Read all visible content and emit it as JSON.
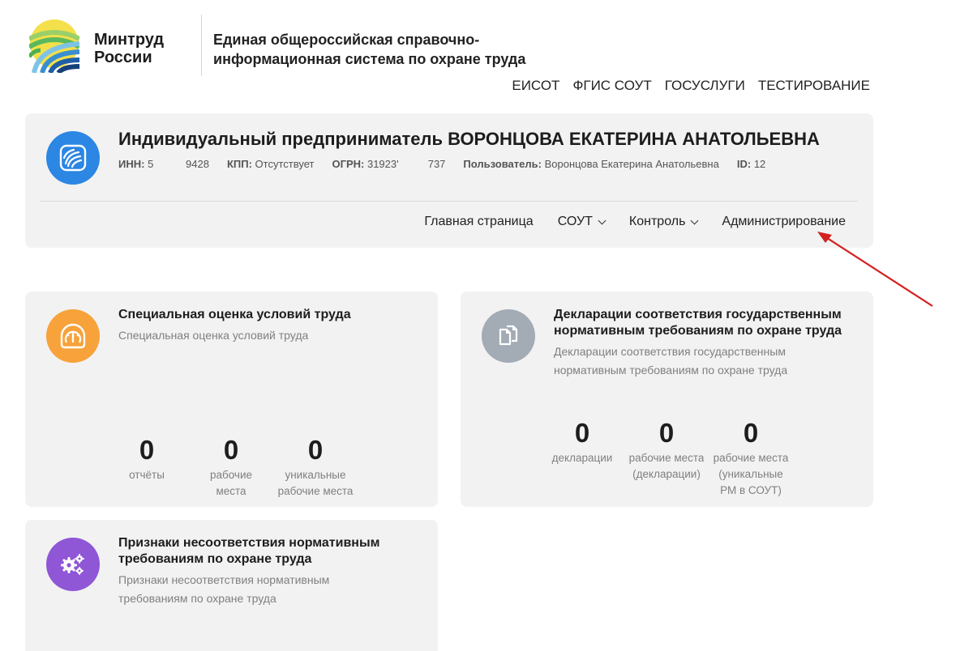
{
  "header": {
    "brand_line1": "Минтруд",
    "brand_line2": "России",
    "system_title_line1": "Единая общероссийская справочно-",
    "system_title_line2": "информационная система по охране труда",
    "nav": [
      "ЕИСОТ",
      "ФГИС СОУТ",
      "ГОСУСЛУГИ",
      "ТЕСТИРОВАНИЕ"
    ]
  },
  "org": {
    "name": "Индивидуальный предприниматель ВОРОНЦОВА ЕКАТЕРИНА АНАТОЛЬЕВНА",
    "inn_label": "ИНН:",
    "inn_value": "5           9428",
    "kpp_label": "КПП:",
    "kpp_value": "Отсутствует",
    "ogrn_label": "ОГРН:",
    "ogrn_value": "31923'          737",
    "user_label": "Пользователь:",
    "user_value": "Воронцова Екатерина Анатольевна",
    "id_label": "ID:",
    "id_value": "12",
    "nav": {
      "home": "Главная страница",
      "sout": "СОУТ",
      "control": "Контроль",
      "admin": "Администрирование"
    }
  },
  "cards": {
    "sout": {
      "title": "Специальная оценка условий труда",
      "desc": "Специальная оценка условий труда",
      "stats": [
        {
          "value": "0",
          "label_1": "отчёты",
          "label_2": ""
        },
        {
          "value": "0",
          "label_1": "рабочие",
          "label_2": "места"
        },
        {
          "value": "0",
          "label_1": "уникальные",
          "label_2": "рабочие места"
        }
      ]
    },
    "decl": {
      "title_1": "Декларации соответствия государственным",
      "title_2": "нормативным требованиям по охране труда",
      "desc_1": "Декларации соответствия государственным",
      "desc_2": "нормативным требованиям по охране труда",
      "stats": [
        {
          "value": "0",
          "label_1": "декларации",
          "label_2": "",
          "label_3": ""
        },
        {
          "value": "0",
          "label_1": "рабочие места",
          "label_2": "(декларации)",
          "label_3": ""
        },
        {
          "value": "0",
          "label_1": "рабочие места",
          "label_2": "(уникальные",
          "label_3": "РМ в СОУТ)"
        }
      ]
    },
    "nonconf": {
      "title_1": "Признаки несоответствия нормативным",
      "title_2": "требованиям по охране труда",
      "desc_1": "Признаки несоответствия нормативным",
      "desc_2": "требованиям по охране труда"
    }
  },
  "colors": {
    "org_icon": "#2b86e4",
    "sout_icon": "#f7a23b",
    "decl_icon": "#a3abb5",
    "nonconf_icon": "#8f56d6",
    "arrow": "#d42020"
  }
}
